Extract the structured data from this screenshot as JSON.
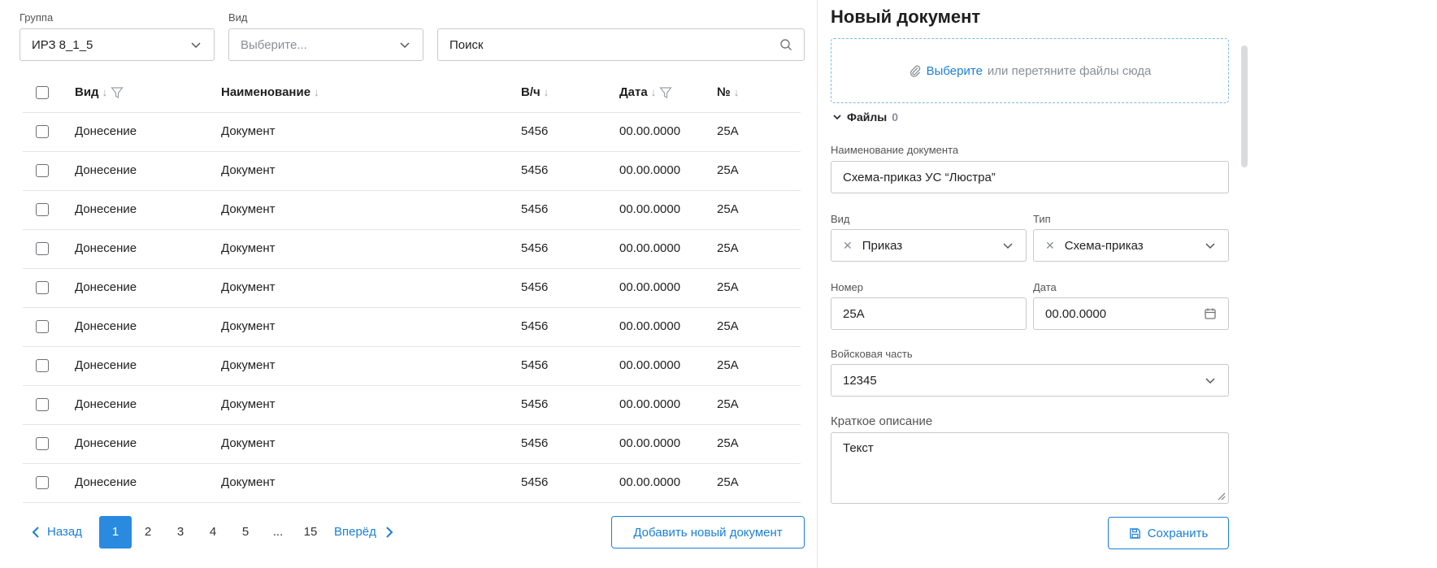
{
  "filters": {
    "group": {
      "label": "Группа",
      "value": "ИРЗ 8_1_5"
    },
    "kind": {
      "label": "Вид",
      "placeholder": "Выберите..."
    },
    "search": {
      "value": "Поиск"
    }
  },
  "table": {
    "columns": [
      "Вид",
      "Наименование",
      "В/ч",
      "Дата",
      "№"
    ],
    "rows": [
      [
        "Донесение",
        "Документ",
        "5456",
        "00.00.0000",
        "25А"
      ],
      [
        "Донесение",
        "Документ",
        "5456",
        "00.00.0000",
        "25А"
      ],
      [
        "Донесение",
        "Документ",
        "5456",
        "00.00.0000",
        "25А"
      ],
      [
        "Донесение",
        "Документ",
        "5456",
        "00.00.0000",
        "25А"
      ],
      [
        "Донесение",
        "Документ",
        "5456",
        "00.00.0000",
        "25А"
      ],
      [
        "Донесение",
        "Документ",
        "5456",
        "00.00.0000",
        "25А"
      ],
      [
        "Донесение",
        "Документ",
        "5456",
        "00.00.0000",
        "25А"
      ],
      [
        "Донесение",
        "Документ",
        "5456",
        "00.00.0000",
        "25А"
      ],
      [
        "Донесение",
        "Документ",
        "5456",
        "00.00.0000",
        "25А"
      ],
      [
        "Донесение",
        "Документ",
        "5456",
        "00.00.0000",
        "25А"
      ]
    ]
  },
  "pagination": {
    "prev": "Назад",
    "next": "Вперёд",
    "pages": [
      "1",
      "2",
      "3",
      "4",
      "5",
      "...",
      "15"
    ],
    "active": "1"
  },
  "add_button": "Добавить новый документ",
  "panel": {
    "title": "Новый документ",
    "dropzone": {
      "link": "Выберите",
      "text": "или перетяните файлы сюда"
    },
    "files": {
      "label": "Файлы",
      "count": "0"
    },
    "doc_name": {
      "label": "Наименование документа",
      "value": "Схема-приказ  УС “Люстра”"
    },
    "kind": {
      "label": "Вид",
      "value": "Приказ"
    },
    "type": {
      "label": "Тип",
      "value": "Схема-приказ"
    },
    "number": {
      "label": "Номер",
      "value": "25А"
    },
    "date": {
      "label": "Дата",
      "value": "00.00.0000"
    },
    "unit": {
      "label": "Войсковая часть",
      "value": "12345"
    },
    "description": {
      "label": "Краткое описание",
      "value": "Текст"
    },
    "save": "Сохранить"
  },
  "colors": {
    "accent": "#1a7fd6",
    "active_page": "#2a8ae0",
    "dropzone_border": "#7fb8ea"
  }
}
